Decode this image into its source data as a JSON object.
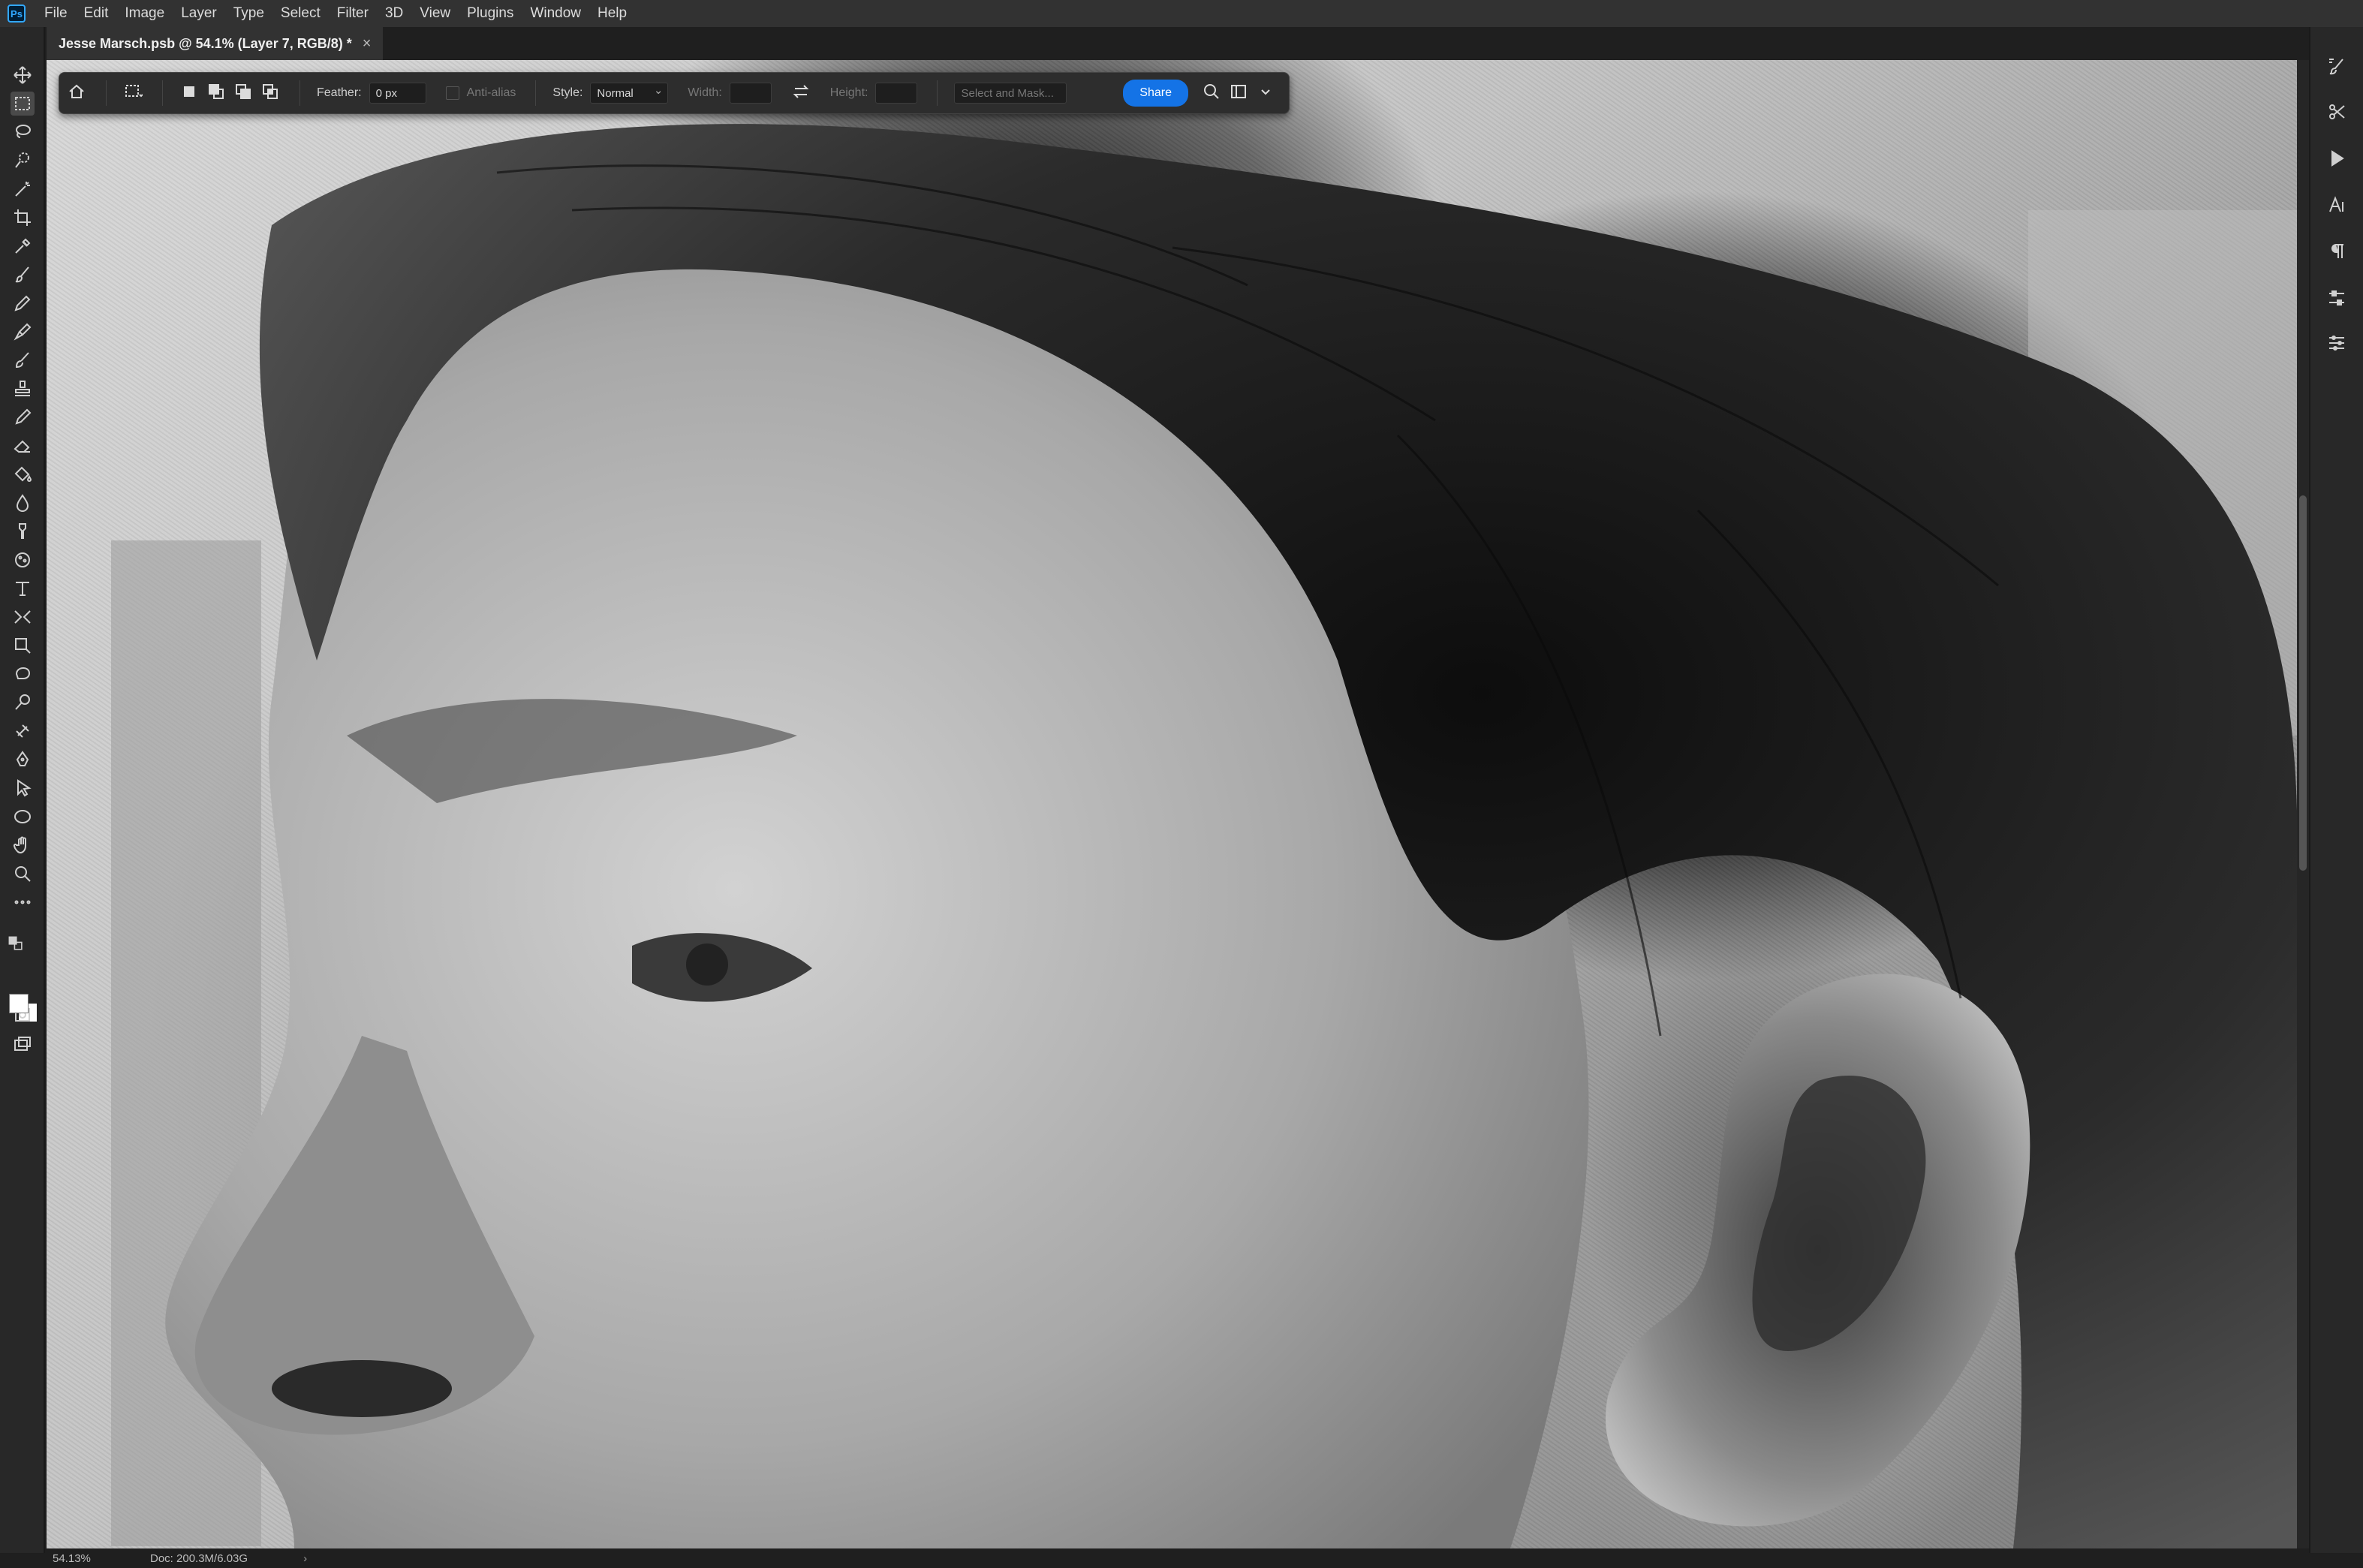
{
  "app": {
    "logo_text": "Ps",
    "accent": "#31a8ff"
  },
  "menu": [
    "File",
    "Edit",
    "Image",
    "Layer",
    "Type",
    "Select",
    "Filter",
    "3D",
    "View",
    "Plugins",
    "Window",
    "Help"
  ],
  "document_tab": {
    "title": "Jesse Marsch.psb @ 54.1% (Layer 7, RGB/8) *",
    "close_glyph": "×"
  },
  "options_bar": {
    "feather_label": "Feather:",
    "feather_value": "0 px",
    "antialias_label": "Anti-alias",
    "style_label": "Style:",
    "style_value": "Normal",
    "width_label": "Width:",
    "height_label": "Height:",
    "select_mask_label": "Select and Mask...",
    "share_label": "Share",
    "share_color": "#1473e6"
  },
  "tools": [
    "move-tool-icon",
    "marquee-tool-icon",
    "lasso-tool-icon",
    "quick-select-tool-icon",
    "magic-wand-tool-icon",
    "crop-tool-icon",
    "eyedropper-tool-icon",
    "brush-tool-icon",
    "pencil-tool-icon",
    "mixer-brush-tool-icon",
    "history-brush-tool-icon",
    "stamp-tool-icon",
    "pattern-stamp-tool-icon",
    "eraser-tool-icon",
    "paint-bucket-tool-icon",
    "blur-tool-icon",
    "smudge-tool-icon",
    "sponge-tool-icon",
    "type-tool-icon",
    "puppet-warp-tool-icon",
    "transform-tool-icon",
    "blob-tool-icon",
    "dodge-tool-icon",
    "healing-tool-icon",
    "pen-tool-icon",
    "path-select-tool-icon",
    "ellipse-tool-icon",
    "hand-tool-icon",
    "zoom-tool-icon",
    "more-tools-icon"
  ],
  "status": {
    "zoom": "54.13%",
    "doc_size": "Doc: 200.3M/6.03G",
    "arrow": "›"
  }
}
